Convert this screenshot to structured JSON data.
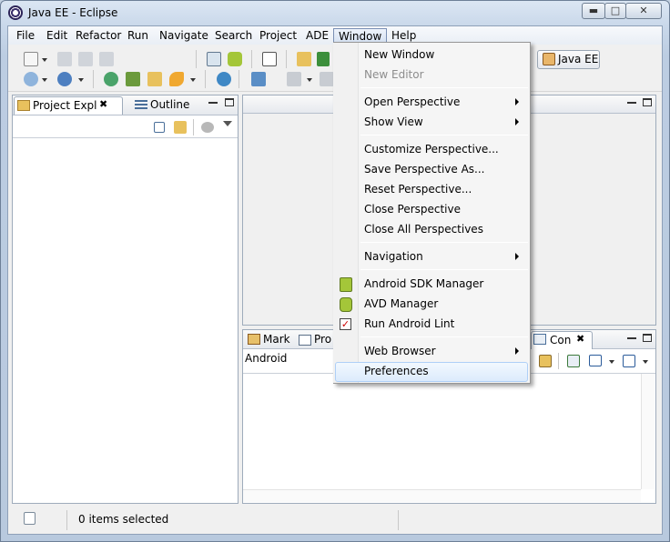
{
  "window": {
    "title": "Java EE - Eclipse"
  },
  "menubar": {
    "items": [
      "File",
      "Edit",
      "Refactor",
      "Run",
      "Navigate",
      "Search",
      "Project",
      "ADE",
      "Window",
      "Help"
    ],
    "active": "Window"
  },
  "toolbar": {
    "perspective_label": "Java EE"
  },
  "left_view": {
    "tabs": [
      {
        "label": "Project Expl"
      },
      {
        "label": "Outline"
      }
    ]
  },
  "bottom_view": {
    "tabs": [
      {
        "label": "Mark"
      },
      {
        "label": "Pro"
      },
      {
        "label": "Con"
      }
    ],
    "console_label": "Android"
  },
  "window_menu": {
    "items": [
      {
        "label": "New Window"
      },
      {
        "label": "New Editor",
        "disabled": true
      },
      {
        "label": "Open Perspective",
        "submenu": true
      },
      {
        "label": "Show View",
        "submenu": true
      },
      {
        "label": "Customize Perspective..."
      },
      {
        "label": "Save Perspective As..."
      },
      {
        "label": "Reset Perspective..."
      },
      {
        "label": "Close Perspective"
      },
      {
        "label": "Close All Perspectives"
      },
      {
        "label": "Navigation",
        "submenu": true
      },
      {
        "label": "Android SDK Manager"
      },
      {
        "label": "AVD Manager"
      },
      {
        "label": "Run Android Lint"
      },
      {
        "label": "Web Browser",
        "submenu": true
      },
      {
        "label": "Preferences",
        "highlighted": true
      }
    ]
  },
  "statusbar": {
    "text": "0 items selected"
  },
  "colors": {
    "menu_highlight": "#dcebfc",
    "title_bg": "#c9d8ea"
  }
}
